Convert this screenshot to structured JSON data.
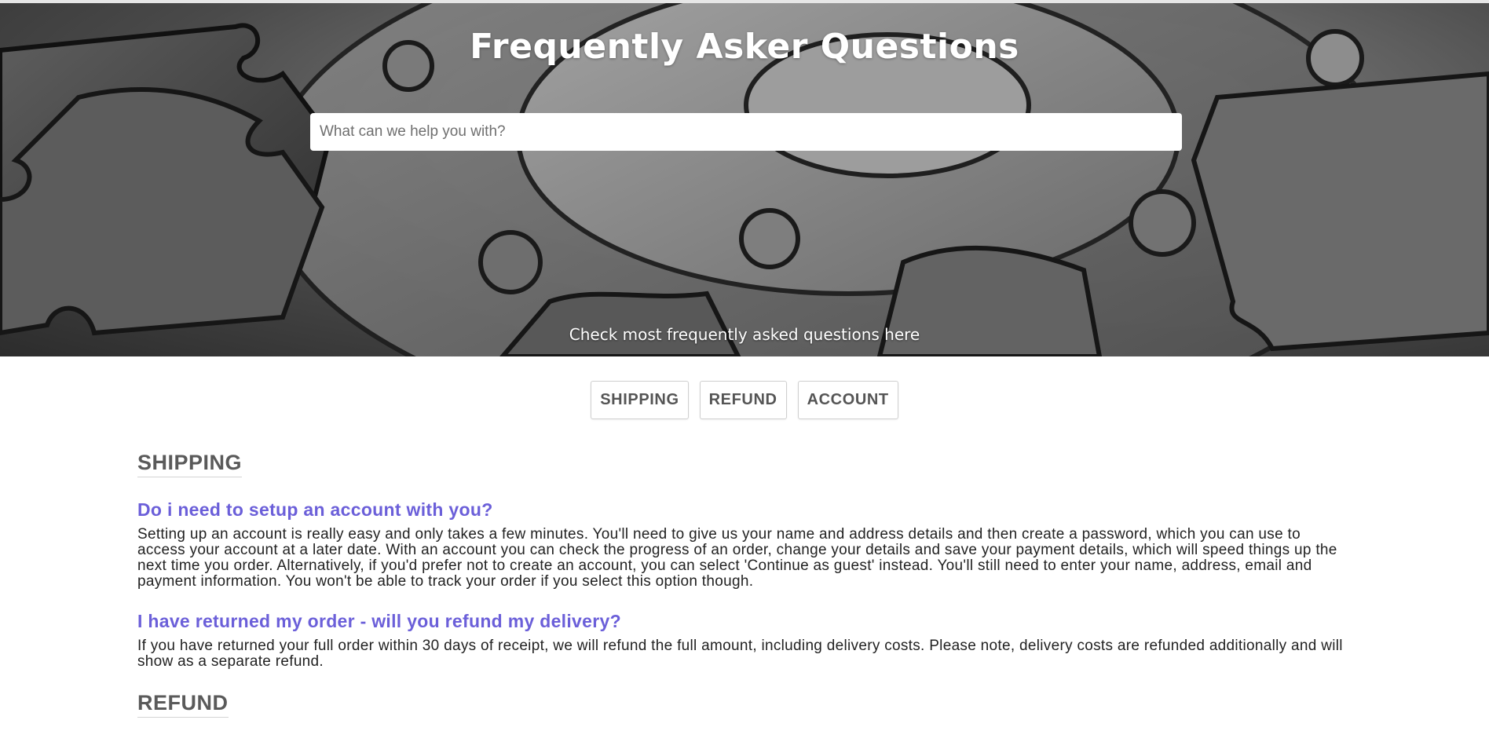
{
  "hero": {
    "title": "Frequently Asker Questions",
    "search_placeholder": "What can we help you with?",
    "subtitle": "Check most frequently asked questions here"
  },
  "tabs": [
    {
      "label": "SHIPPING"
    },
    {
      "label": "REFUND"
    },
    {
      "label": "ACCOUNT"
    }
  ],
  "sections": [
    {
      "title": "SHIPPING",
      "faqs": [
        {
          "question": "Do i need to setup an account with you?",
          "answer": "Setting up an account is really easy and only takes a few minutes. You'll need to give us your name and address details and then create a password, which you can use to access your account at a later date. With an account you can check the progress of an order, change your details and save your payment details, which will speed things up the next time you order. Alternatively, if you'd prefer not to create an account, you can select 'Continue as guest' instead. You'll still need to enter your name, address, email and payment information. You won't be able to track your order if you select this option though."
        },
        {
          "question": "I have returned my order - will you refund my delivery?",
          "answer": "If you have returned your full order within 30 days of receipt, we will refund the full amount, including delivery costs. Please note, delivery costs are refunded additionally and will show as a separate refund."
        }
      ]
    },
    {
      "title": "REFUND"
    }
  ],
  "colors": {
    "question": "#6b5fd9",
    "section_title": "#5a5a5a",
    "tab_text": "#555555"
  },
  "icons": {
    "hero_background": "puzzle-pieces-background"
  }
}
